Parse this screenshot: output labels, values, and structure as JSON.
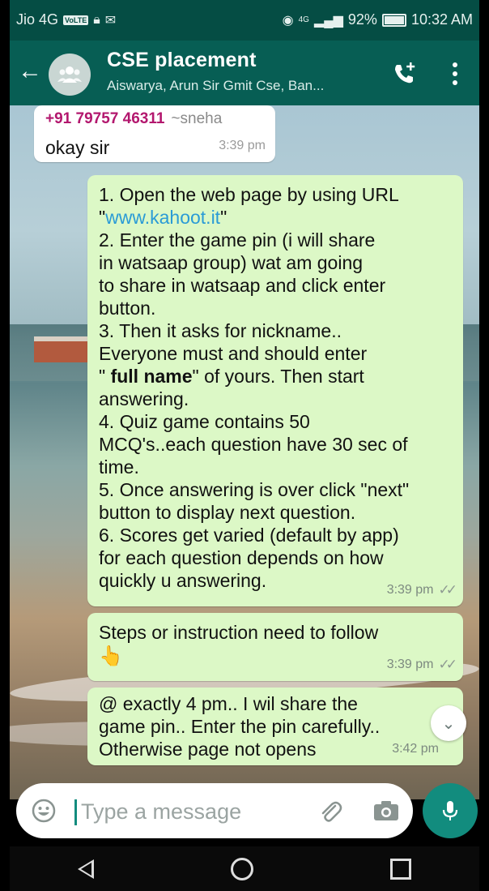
{
  "status_bar": {
    "carrier": "Jio 4G",
    "volte": "VoLTE",
    "network": "4G",
    "battery": "92%",
    "battery_level": 0.92,
    "time": "10:32 AM"
  },
  "header": {
    "title": "CSE placement",
    "subtitle": "Aiswarya, Arun Sir Gmit Cse, Ban..."
  },
  "messages": [
    {
      "direction": "incoming",
      "sender_number": "+91 79757 46311",
      "sender_alias": "~sneha",
      "text": "okay sir",
      "time": "3:39 pm"
    },
    {
      "direction": "outgoing",
      "lines": {
        "l1": "1. Open the web page by  using URL",
        "l2_quote_open": "\"",
        "l2_link": "www.kahoot.it",
        "l2_quote_close": "\"",
        "l3": "2. Enter the game pin (i will share",
        "l4": "in watsaap group) wat am going",
        "l5": "to share in watsaap and click enter",
        "l6": "button.",
        "l7": "3. Then it asks for nickname..",
        "l8": "Everyone must and should enter",
        "l9_pre": "\" ",
        "l9_bold": "full name",
        "l9_post": "\" of yours. Then start",
        "l10": "answering.",
        "l11": "4. Quiz game contains 50",
        "l12": "MCQ's..each question have 30 sec of",
        "l13": "time.",
        "l14": "5. Once answering is over click \"next\"",
        "l15": "button to display next question.",
        "l16": "6. Scores get varied (default by app)",
        "l17": "for each question depends on how",
        "l18": "quickly u answering."
      },
      "time": "3:39 pm"
    },
    {
      "direction": "outgoing",
      "text": "Steps or instruction need to follow",
      "emoji": "👆",
      "time": "3:39 pm"
    },
    {
      "direction": "outgoing",
      "lines": {
        "l1": "@ exactly 4 pm.. I wil share the",
        "l2": "game pin.. Enter the pin carefully..",
        "l3": "Otherwise page not opens"
      },
      "time": "3:42 pm"
    }
  ],
  "input": {
    "placeholder": "Type a message"
  },
  "icons": {
    "back": "back-arrow-icon",
    "avatar": "group-avatar-icon",
    "call": "add-call-icon",
    "menu": "more-vert-icon",
    "emoji": "emoji-icon",
    "attach": "attachment-icon",
    "camera": "camera-icon",
    "mic": "mic-icon",
    "scroll": "chevron-double-down-icon"
  },
  "colors": {
    "header": "#075e54",
    "status_bar": "#054d44",
    "outgoing_bubble": "#dcf8c6",
    "incoming_bubble": "#ffffff",
    "accent": "#128c7e",
    "sender_name": "#b3176e",
    "link": "#2a9bd6"
  }
}
